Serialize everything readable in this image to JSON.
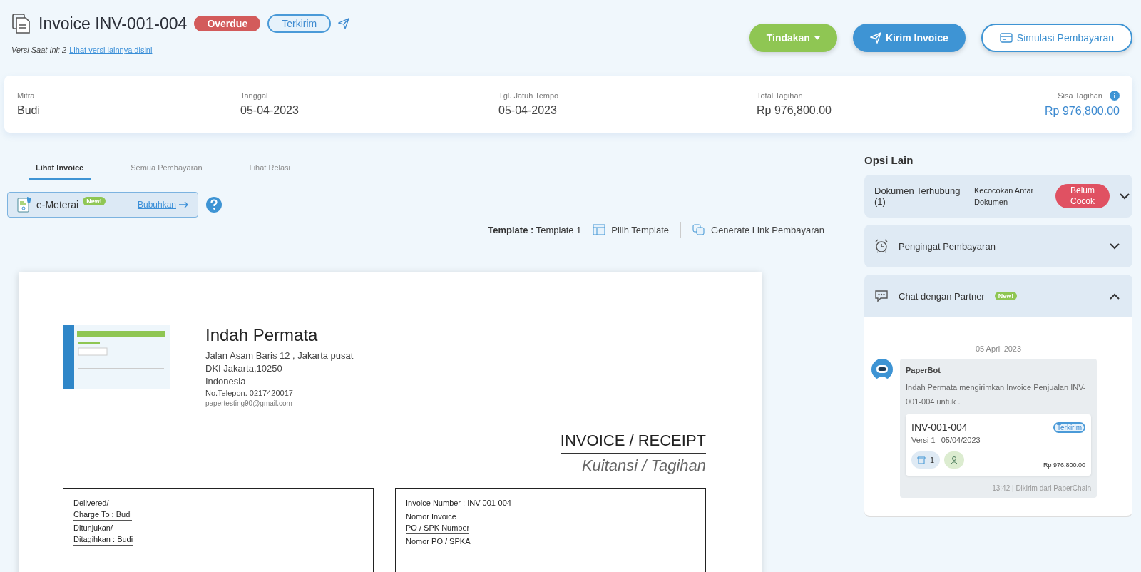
{
  "header": {
    "title": "Invoice INV-001-004",
    "badges": [
      {
        "label": "Overdue",
        "kind": "danger"
      },
      {
        "label": "Terkirim",
        "kind": "outline"
      }
    ],
    "version_label": "Versi Saat Ini: 2",
    "version_link": "Lihat versi lainnya disini",
    "actions": [
      {
        "label": "Tindakan",
        "kind": "dropdown"
      },
      {
        "label": "Kirim Invoice",
        "kind": "send"
      },
      {
        "label": "Simulasi Pembayaran",
        "kind": "outline"
      }
    ]
  },
  "summary": [
    {
      "label": "Mitra",
      "value": "Budi",
      "highlight": false,
      "info": false
    },
    {
      "label": "Tanggal",
      "value": "05-04-2023",
      "highlight": false,
      "info": false
    },
    {
      "label": "Tgl. Jatuh Tempo",
      "value": "05-04-2023",
      "highlight": false,
      "info": false
    },
    {
      "label": "Total Tagihan",
      "value": "Rp 976,800.00",
      "highlight": false,
      "info": false
    },
    {
      "label": "Sisa Tagihan",
      "value": "Rp 976,800.00",
      "highlight": true,
      "info": true
    }
  ],
  "tabs": [
    {
      "label": "Lihat Invoice",
      "selected": true
    },
    {
      "label": "Semua Pembayaran",
      "selected": false
    },
    {
      "label": "Lihat Relasi",
      "selected": false
    }
  ],
  "emeterai": {
    "label": "e-Meterai",
    "badge": "New!",
    "link": "Bubuhkan"
  },
  "template": {
    "label": "Template :",
    "value": "Template 1"
  },
  "toolbar": [
    {
      "label": "Pilih Template",
      "kind": "template"
    },
    {
      "label": "Generate Link Pembayaran",
      "kind": "link"
    }
  ],
  "document": {
    "company": "Indah Permata",
    "address": [
      "Jalan Asam Baris 12 , Jakarta pusat",
      "DKI Jakarta,10250",
      "Indonesia"
    ],
    "phone": "No.Telepon. 0217420017",
    "email": "papertesting90@gmail.com",
    "title": "INVOICE / RECEIPT",
    "subtitle": "Kuitansi / Tagihan",
    "boxes": [
      [
        {
          "text": "Delivered/",
          "underlined": false
        },
        {
          "text": "Charge To : Budi",
          "underlined": true
        },
        {
          "text": "Ditunjukan/",
          "underlined": false
        },
        {
          "text": "Ditagihkan : Budi",
          "underlined": true
        }
      ],
      [
        {
          "text": "Invoice Number : INV-001-004",
          "underlined": true
        },
        {
          "text": "Nomor Invoice",
          "underlined": false
        },
        {
          "text": "PO / SPK Number",
          "underlined": true
        },
        {
          "text": "Nomor PO / SPKA",
          "underlined": false
        }
      ]
    ]
  },
  "side": {
    "title": "Opsi Lain",
    "panels": [
      {
        "kind": "linked",
        "title": "Dokumen Terhubung (1)",
        "note": "Kecocokan Antar Dokumen",
        "badge": "Belum Cocok",
        "expanded": false
      },
      {
        "kind": "reminder",
        "title": "Pengingat Pembayaran",
        "expanded": false
      },
      {
        "kind": "chat",
        "title": "Chat dengan Partner",
        "badge": "New!",
        "expanded": true
      }
    ],
    "chat": {
      "date": "05 April 2023",
      "sender": "PaperBot",
      "message": "Indah Permata mengirimkan Invoice Penjualan INV-001-004 untuk .",
      "card": {
        "number": "INV-001-004",
        "version": "Versi 1",
        "date": "05/04/2023",
        "status": "Terkirim",
        "count": "1",
        "amount": "Rp 976,800.00"
      },
      "footer": "13:42 | Dikirim dari PaperChain"
    }
  }
}
